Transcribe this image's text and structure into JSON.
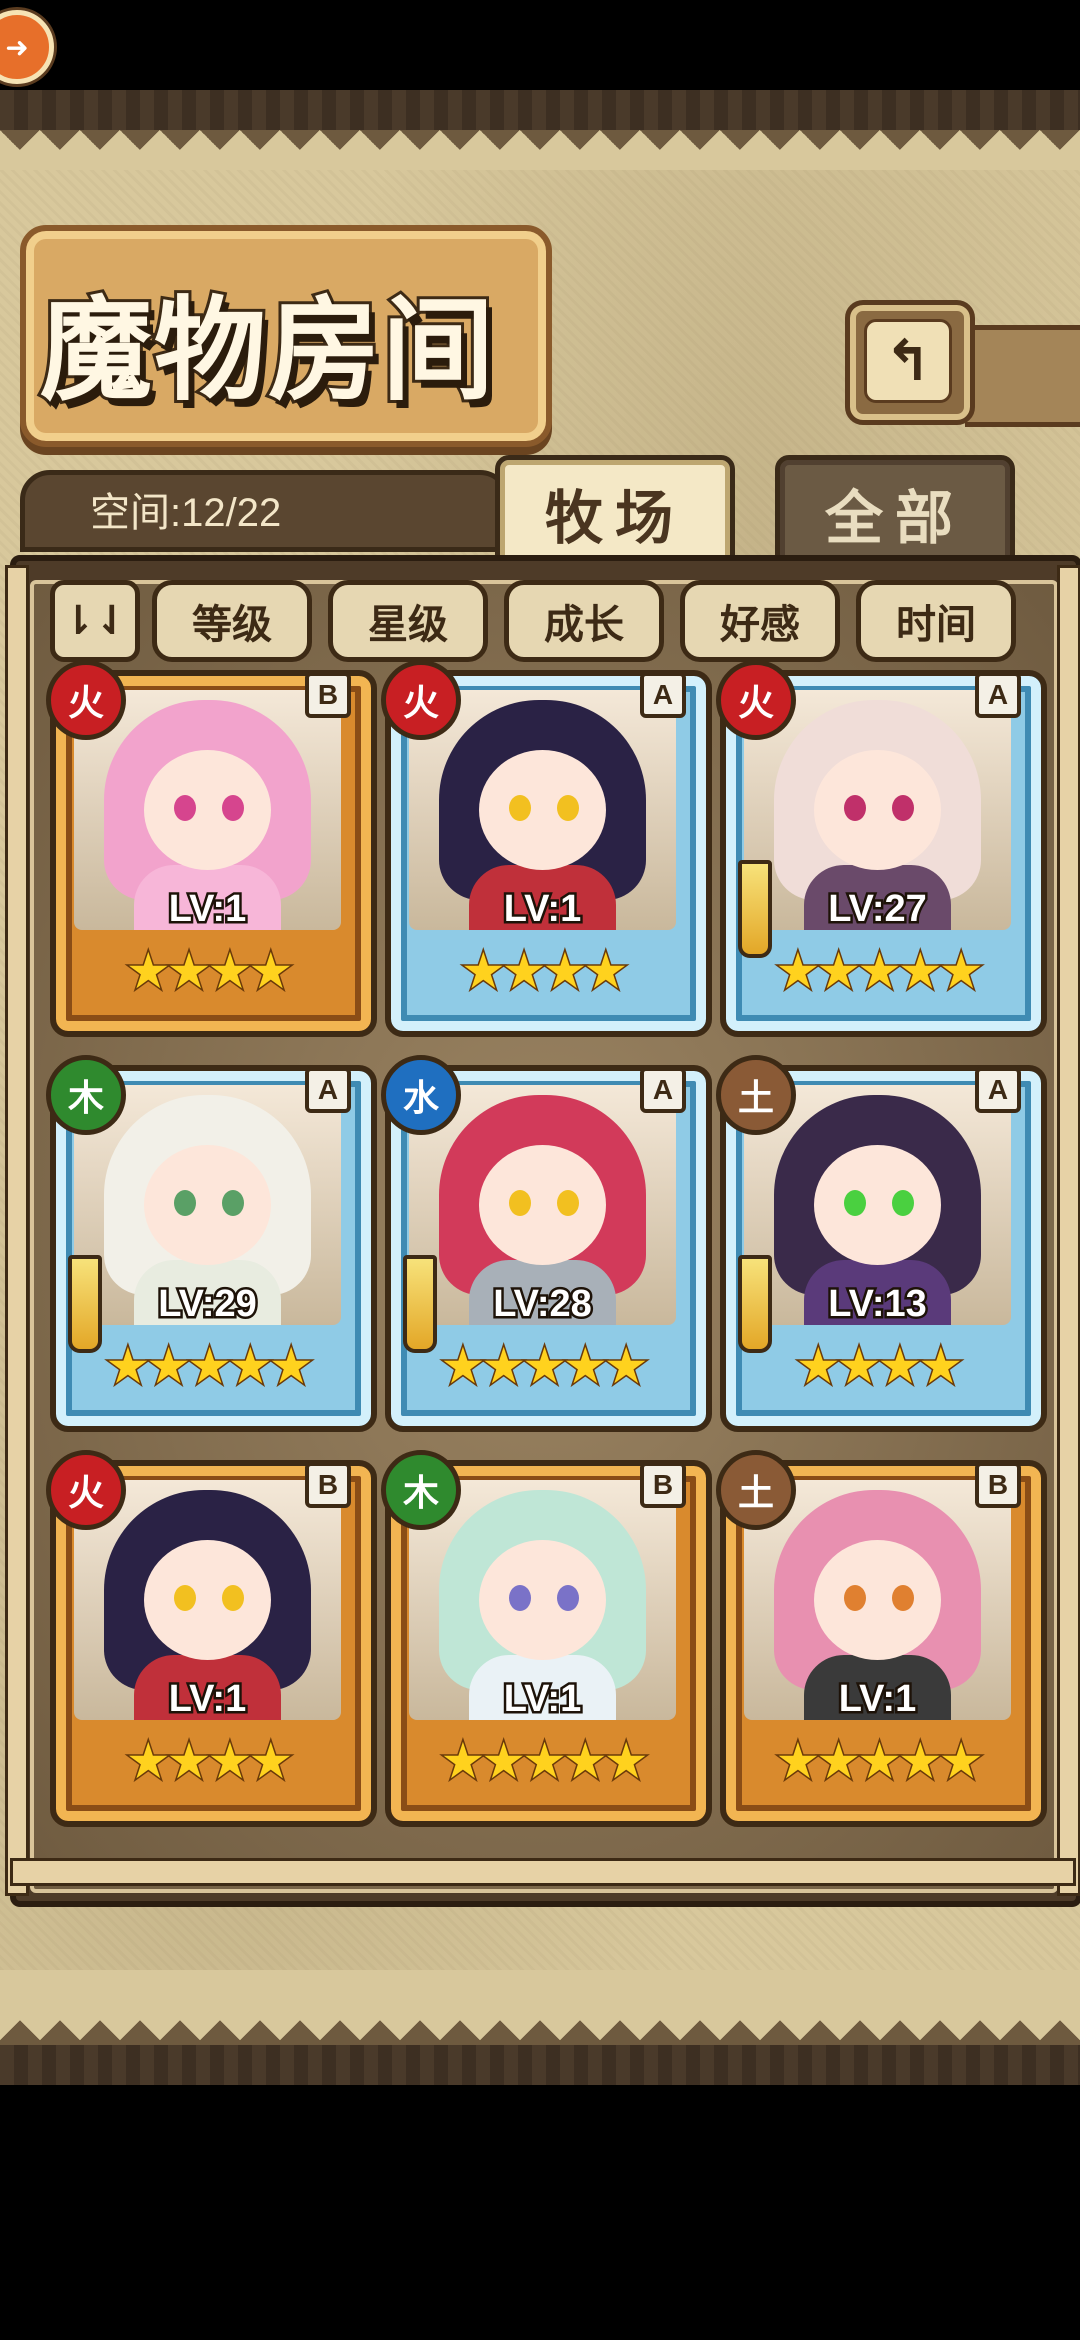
{
  "title": "魔物房间",
  "space": {
    "label": "空间:12/22"
  },
  "tabs": [
    {
      "label": "牧场",
      "active": true
    },
    {
      "label": "全部",
      "active": false
    }
  ],
  "back_icon": "return-arrow-icon",
  "sort_toggle": {
    "label": "⇂⇃",
    "icon": "sort-toggle-icon"
  },
  "filters": [
    "等级",
    "星级",
    "成长",
    "好感",
    "时间"
  ],
  "colors": {
    "fire": "#c81f23",
    "wood": "#2f8a2e",
    "water": "#1f6fc0",
    "earth": "#8a5a36",
    "rankB": "#d98a2d",
    "rankA": "#8fcbe6"
  },
  "monsters": [
    {
      "element": "fire",
      "element_glyph": "火",
      "rank": "B",
      "level": "LV:1",
      "stars": "★★★★",
      "has_sword": false,
      "hair": "#f2a3cc",
      "eyes": "#d6458e",
      "body": "#f7b6d8"
    },
    {
      "element": "fire",
      "element_glyph": "火",
      "rank": "A",
      "level": "LV:1",
      "stars": "★★★★",
      "has_sword": false,
      "hair": "#2a2245",
      "eyes": "#f2c020",
      "body": "#c0303a"
    },
    {
      "element": "fire",
      "element_glyph": "火",
      "rank": "A",
      "level": "LV:27",
      "stars": "★★★★★",
      "has_sword": true,
      "hair": "#f0ddd8",
      "eyes": "#c0306a",
      "body": "#6a4a6a"
    },
    {
      "element": "wood",
      "element_glyph": "木",
      "rank": "A",
      "level": "LV:29",
      "stars": "★★★★★",
      "has_sword": true,
      "hair": "#f2f0e8",
      "eyes": "#5aa066",
      "body": "#e8ece0"
    },
    {
      "element": "water",
      "element_glyph": "水",
      "rank": "A",
      "level": "LV:28",
      "stars": "★★★★★",
      "has_sword": true,
      "hair": "#d23a5a",
      "eyes": "#f2c020",
      "body": "#a8b0b8"
    },
    {
      "element": "earth",
      "element_glyph": "土",
      "rank": "A",
      "level": "LV:13",
      "stars": "★★★★",
      "has_sword": true,
      "hair": "#3a2a4a",
      "eyes": "#4ad040",
      "body": "#5a3a7a"
    },
    {
      "element": "fire",
      "element_glyph": "火",
      "rank": "B",
      "level": "LV:1",
      "stars": "★★★★",
      "has_sword": false,
      "hair": "#2a2245",
      "eyes": "#f2c020",
      "body": "#c0303a"
    },
    {
      "element": "wood",
      "element_glyph": "木",
      "rank": "B",
      "level": "LV:1",
      "stars": "★★★★★",
      "has_sword": false,
      "hair": "#bfe6d6",
      "eyes": "#7a72c8",
      "body": "#eaf2f6"
    },
    {
      "element": "earth",
      "element_glyph": "土",
      "rank": "B",
      "level": "LV:1",
      "stars": "★★★★★",
      "has_sword": false,
      "hair": "#e890b0",
      "eyes": "#e08030",
      "body": "#3a3a3a"
    }
  ]
}
